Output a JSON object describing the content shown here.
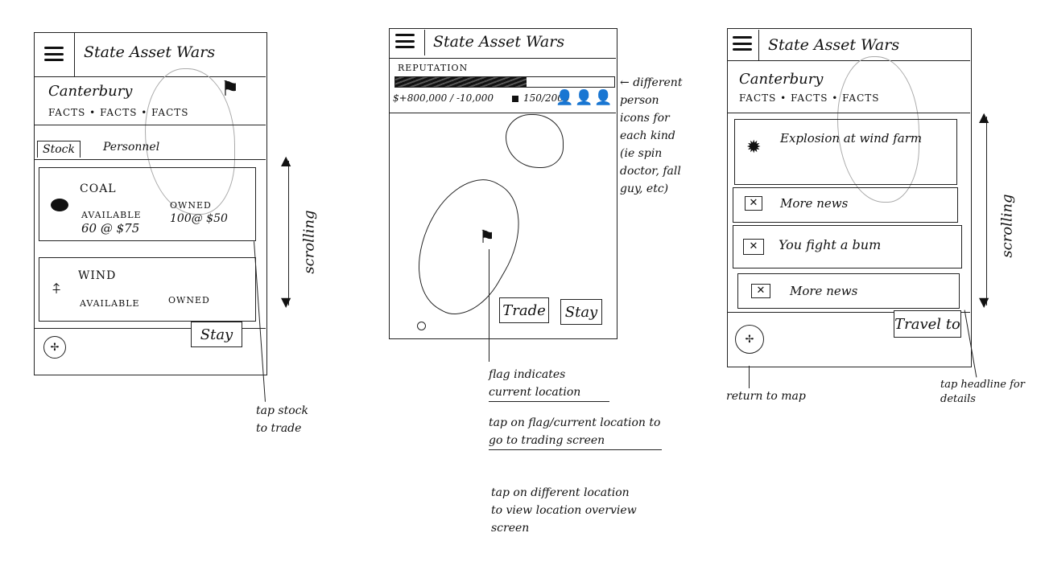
{
  "screens": [
    {
      "header": {
        "title": "State Asset Wars",
        "menu_icon": "hamburger-icon"
      },
      "location": {
        "name": "Canterbury",
        "facts": "FACTS • FACTS • FACTS",
        "icon": "flag-icon"
      },
      "tabs": [
        {
          "label": "Stock"
        },
        {
          "label": "Personnel"
        }
      ],
      "stocks": [
        {
          "name": "COAL",
          "icon": "coal-lump-icon",
          "available_label": "AVAILABLE",
          "available_value": "60 @ $75",
          "owned_label": "OWNED",
          "owned_value": "100@ $50"
        },
        {
          "name": "WIND",
          "icon": "wind-turbine-icon",
          "available_label": "AVAILABLE",
          "owned_label": "OWNED"
        }
      ],
      "footer": {
        "map_icon": "map-compass-icon",
        "button": "Stay"
      },
      "annotations": {
        "scrolling": "scrolling",
        "tap_stock": "tap stock to trade"
      }
    },
    {
      "header": {
        "title": "State Asset Wars",
        "menu_icon": "hamburger-icon"
      },
      "reputation": {
        "label": "REPUTATION",
        "level": 0.6
      },
      "stats": {
        "money": "$+800,000 / -10,000",
        "count": "150/2000",
        "person_icons": [
          "spin-doctor-icon",
          "fall-guy-icon",
          "person-icon"
        ]
      },
      "buttons": {
        "trade": "Trade",
        "stay": "Stay"
      },
      "annotations": {
        "person_icons": "different person icons for each kind (ie spin doctor, fall guy, etc)",
        "flag": "flag indicates current location",
        "tap_flag": "tap on flag/current location to go to trading screen",
        "tap_other": "tap on different location to view location overview screen"
      }
    },
    {
      "header": {
        "title": "State Asset Wars",
        "menu_icon": "hamburger-icon"
      },
      "location": {
        "name": "Canterbury",
        "facts": "FACTS • FACTS • FACTS"
      },
      "news": [
        {
          "headline": "Explosion at wind farm",
          "icon": "explosion-icon"
        },
        {
          "headline": "More news",
          "icon": "image-placeholder-icon"
        },
        {
          "headline": "You fight a bum",
          "icon": "image-placeholder-icon"
        },
        {
          "headline": "More news",
          "icon": "image-placeholder-icon"
        }
      ],
      "footer": {
        "map_icon": "map-compass-icon",
        "button": "Travel to"
      },
      "annotations": {
        "scrolling": "scrolling",
        "return_map": "return to map",
        "tap_headline": "tap headline for details"
      }
    }
  ]
}
